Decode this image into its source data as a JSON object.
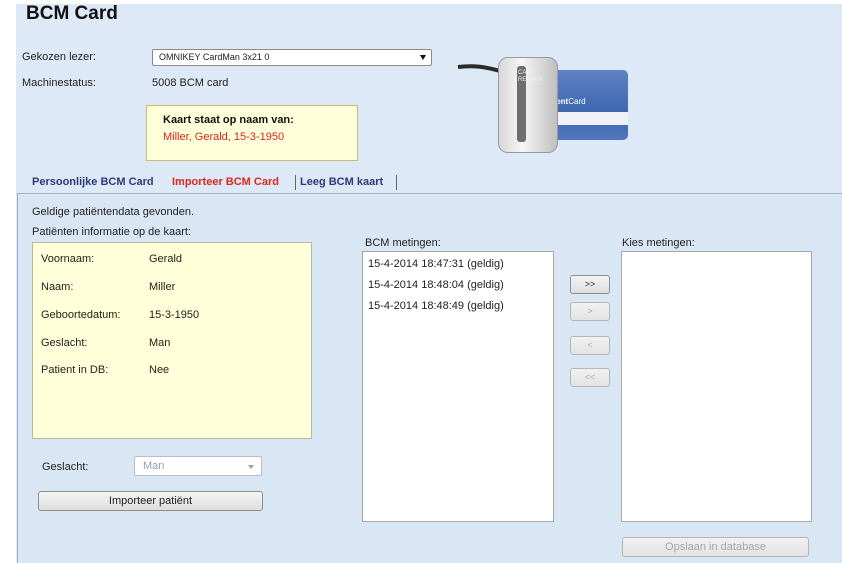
{
  "header": {
    "title": "BCM Card"
  },
  "reader": {
    "selected_label": "Gekozen lezer:",
    "selected_value": "OMNIKEY CardMan 3x21 0",
    "status_label": "Machinestatus:",
    "status_value": "5008 BCM card",
    "image_text": "CARD READER",
    "card_text_bold": "ient",
    "card_text": "Card"
  },
  "owner": {
    "heading": "Kaart staat op naam van:",
    "name": "Miller, Gerald, 15-3-1950"
  },
  "tabs": [
    {
      "label": "Persoonlijke BCM Card",
      "active": false
    },
    {
      "label": "Importeer BCM Card",
      "active": true
    },
    {
      "label": "Leeg BCM kaart",
      "active": false
    }
  ],
  "content": {
    "found_text": "Geldige patiëntendata gevonden.",
    "patient_info_label": "Patiënten informatie op de kaart:",
    "patient": [
      {
        "label": "Voornaam:",
        "value": "Gerald"
      },
      {
        "label": "Naam:",
        "value": "Miller"
      },
      {
        "label": "Geboortedatum:",
        "value": "15-3-1950"
      },
      {
        "label": "Geslacht:",
        "value": "Man"
      },
      {
        "label": "Patient in DB:",
        "value": "Nee"
      }
    ],
    "gender_label": "Geslacht:",
    "gender_value": "Man",
    "import_button": "Importeer patiënt",
    "bcm_label": "BCM metingen:",
    "bcm_items": [
      "15-4-2014 18:47:31 (geldig)",
      "15-4-2014 18:48:04 (geldig)",
      "15-4-2014 18:48:49 (geldig)"
    ],
    "choose_label": "Kies metingen:",
    "move_all_right": ">>",
    "move_right": ">",
    "move_left": "<",
    "move_all_left": "<<",
    "save_button": "Opslaan in database"
  },
  "colors": {
    "accent_red": "#e0241b",
    "tab_blue": "#2a3b78",
    "panel_bg": "#dde9f6",
    "note_bg": "#ffffd9"
  }
}
